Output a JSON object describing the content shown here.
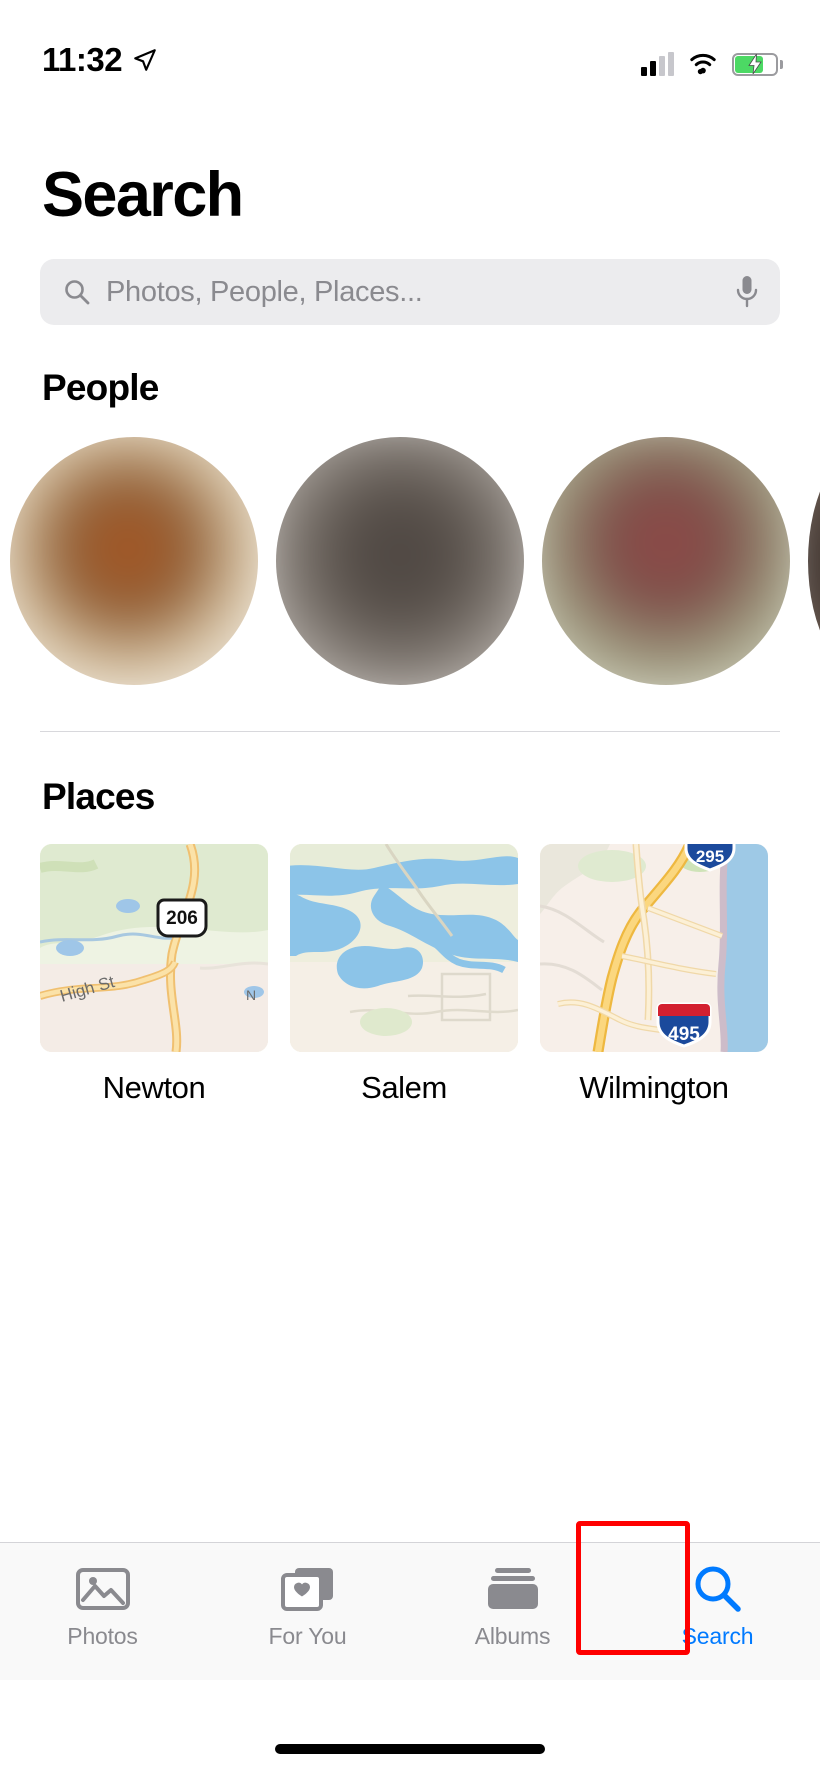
{
  "status_bar": {
    "time": "11:32",
    "location_icon": "location-arrow-icon",
    "cellular_icon": "cellular-signal-icon",
    "wifi_icon": "wifi-icon",
    "battery_icon": "battery-charging-icon",
    "battery_charging": true
  },
  "header": {
    "title": "Search"
  },
  "search": {
    "placeholder": "Photos, People, Places...",
    "value": "",
    "search_icon": "magnifier-icon",
    "mic_icon": "microphone-icon"
  },
  "people": {
    "title": "People",
    "faces": [
      {
        "label": "person-1"
      },
      {
        "label": "person-2"
      },
      {
        "label": "person-3"
      },
      {
        "label": "person-4"
      }
    ]
  },
  "places": {
    "title": "Places",
    "items": [
      {
        "name": "Newton",
        "map_labels": [
          "206",
          "High St",
          "N"
        ]
      },
      {
        "name": "Salem",
        "map_labels": []
      },
      {
        "name": "Wilmington",
        "map_labels": [
          "495",
          "295"
        ]
      }
    ]
  },
  "tab_bar": {
    "tabs": [
      {
        "label": "Photos",
        "icon": "photos-icon",
        "active": false
      },
      {
        "label": "For You",
        "icon": "for-you-icon",
        "active": false
      },
      {
        "label": "Albums",
        "icon": "albums-icon",
        "active": false
      },
      {
        "label": "Search",
        "icon": "search-icon",
        "active": true
      }
    ],
    "active_color": "#007aff",
    "inactive_color": "#8a8a8f",
    "highlight_color": "#ff0000"
  }
}
